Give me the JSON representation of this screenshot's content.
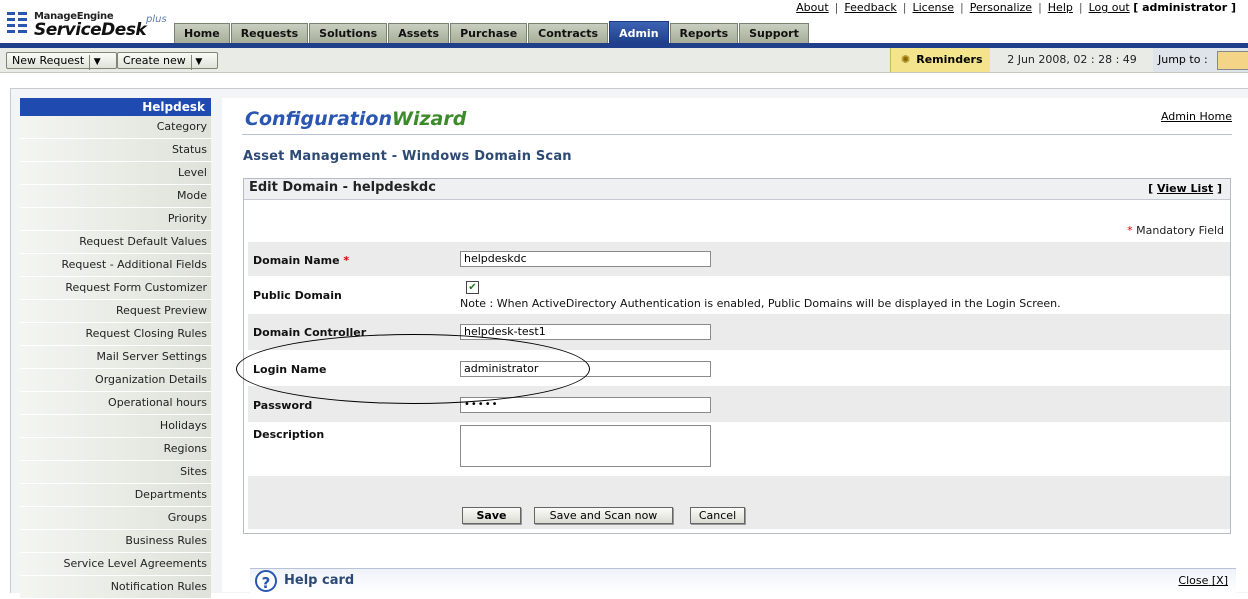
{
  "header": {
    "brand_small": "ManageEngine",
    "brand_big": "ServiceDesk",
    "brand_plus": "plus",
    "top_links": [
      "About",
      "Feedback",
      "License",
      "Personalize",
      "Help",
      "Log out"
    ],
    "user": "[ administrator ]",
    "tabs": [
      "Home",
      "Requests",
      "Solutions",
      "Assets",
      "Purchase",
      "Contracts",
      "Admin",
      "Reports",
      "Support"
    ],
    "active_tab": "Admin"
  },
  "toolbar": {
    "new_request": "New Request",
    "create_new": "Create new",
    "reminders": "Reminders",
    "datetime": "2 Jun 2008, 02 : 28 : 49",
    "jump_to": "Jump to :"
  },
  "sidebar": {
    "heading": "Helpdesk",
    "items": [
      "Category",
      "Status",
      "Level",
      "Mode",
      "Priority",
      "Request Default Values",
      "Request - Additional Fields",
      "Request Form Customizer",
      "Request Preview",
      "Request Closing Rules",
      "Mail Server Settings",
      "Organization Details",
      "Operational hours",
      "Holidays",
      "Regions",
      "Sites",
      "Departments",
      "Groups",
      "Business Rules",
      "Service Level Agreements",
      "Notification Rules"
    ]
  },
  "main": {
    "wizard_part1": "Configuration",
    "wizard_part2": "Wizard",
    "admin_home": "Admin Home",
    "subtitle": "Asset Management - Windows Domain Scan",
    "edit_title": "Edit Domain - helpdeskdc",
    "view_list": "View List",
    "mandatory_note": "Mandatory Field",
    "form": {
      "domain_name_label": "Domain Name",
      "domain_name_value": "helpdeskdc",
      "public_domain_label": "Public Domain",
      "public_domain_checked": true,
      "public_domain_note": "Note : When ActiveDirectory Authentication is enabled, Public Domains will be displayed in the Login Screen.",
      "domain_controller_label": "Domain Controller",
      "domain_controller_value": "helpdesk-test1",
      "login_name_label": "Login Name",
      "login_name_value": "administrator",
      "password_label": "Password",
      "password_value": "•••••",
      "description_label": "Description",
      "description_value": ""
    },
    "buttons": {
      "save": "Save",
      "save_scan": "Save and Scan now",
      "cancel": "Cancel"
    },
    "help_card": {
      "title": "Help card",
      "close": "Close",
      "close_x": "[X]"
    }
  }
}
